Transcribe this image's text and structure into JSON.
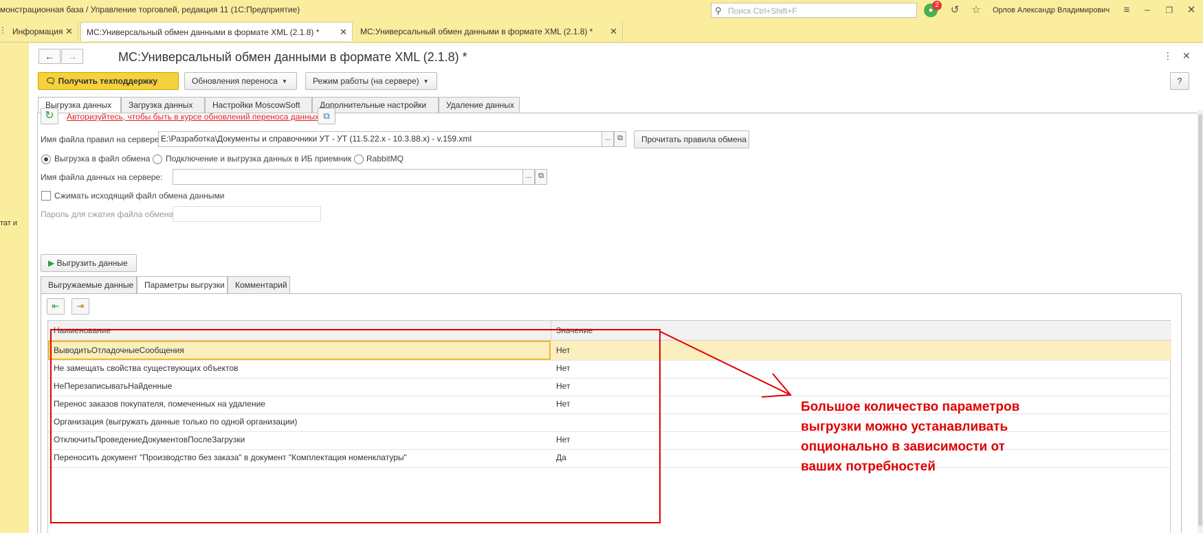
{
  "window": {
    "title": "монстрационная база / Управление торговлей, редакция 11  (1С:Предприятие)",
    "search_placeholder": "Поиск Ctrl+Shift+F",
    "notifications_count": "2",
    "user": "Орлов Александр Владимирович"
  },
  "doc_tabs": [
    {
      "label": "Информация"
    },
    {
      "label": "МС:Универсальный обмен данными в формате XML (2.1.8) *"
    },
    {
      "label": "МС:Универсальный обмен данными в формате XML (2.1.8) *"
    }
  ],
  "left_strip": {
    "label": "тат и"
  },
  "form": {
    "title": "МС:Универсальный обмен данными в формате XML (2.1.8) *",
    "help_label": "?",
    "toolbar": {
      "support_label": "Получить техподдержку",
      "updates_label": "Обновления переноса",
      "mode_label": "Режим работы (на сервере)"
    },
    "tabs": [
      {
        "label": "Выгрузка данных"
      },
      {
        "label": "Загрузка данных"
      },
      {
        "label": "Настройки MoscowSoft"
      },
      {
        "label": "Дополнительные настройки"
      },
      {
        "label": "Удаление данных"
      }
    ],
    "auth_link": "Авторизуйтесь, чтобы быть в курсе обновлений переноса данных",
    "rules_label": "Имя файла правил на сервере:",
    "rules_value": "E:\\Разработка\\Документы и справочники УТ - УТ (11.5.22.x - 10.3.88.x) - v.159.xml",
    "read_rules_label": "Прочитать правила обмена",
    "radio_options": [
      {
        "label": "Выгрузка в файл обмена",
        "checked": true
      },
      {
        "label": "Подключение и выгрузка данных в ИБ приемник",
        "checked": false
      },
      {
        "label": "RabbitMQ",
        "checked": false
      }
    ],
    "data_file_label": "Имя файла данных на сервере:",
    "data_file_value": "",
    "compress_label": "Сжимать исходящий файл обмена данными",
    "password_label": "Пароль для сжатия файла обмена:",
    "export_label": "Выгрузить данные",
    "sub_tabs": [
      {
        "label": "Выгружаемые данные"
      },
      {
        "label": "Параметры выгрузки"
      },
      {
        "label": "Комментарий"
      }
    ],
    "table": {
      "col_name": "Наименование",
      "col_value": "Значение",
      "rows": [
        {
          "name": "ВыводитьОтладочныеСообщения",
          "value": "Нет"
        },
        {
          "name": "Не замещать свойства существующих объектов",
          "value": "Нет"
        },
        {
          "name": "НеПерезаписыватьНайденные",
          "value": "Нет"
        },
        {
          "name": "Перенос заказов покупателя, помеченных на удаление",
          "value": "Нет"
        },
        {
          "name": "Организация (выгружать данные только по одной организации)",
          "value": ""
        },
        {
          "name": "ОтключитьПроведениеДокументовПослеЗагрузки",
          "value": "Нет"
        },
        {
          "name": "Переносить документ \"Производство без заказа\" в документ \"Комплектация номенклатуры\"",
          "value": "Да"
        }
      ]
    }
  },
  "annotation": {
    "lines": [
      "Большое количество параметров",
      "выгрузки можно устанавливать",
      "опционально в зависимости от",
      "ваших потребностей"
    ]
  },
  "colors": {
    "background": "#fbed9e",
    "accent_yellow": "#f5d13b",
    "callout_red": "#e00000",
    "selected_row": "#fbefbf"
  }
}
